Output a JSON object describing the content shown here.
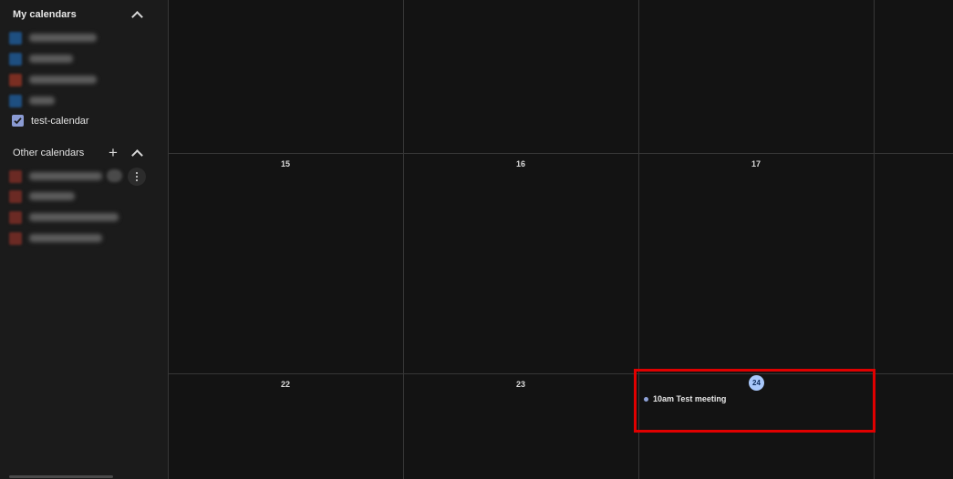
{
  "sidebar": {
    "my_calendars": {
      "title": "My calendars",
      "items": [
        {
          "label": "test-calendar",
          "checked": true,
          "color": "#8b9bd3"
        }
      ],
      "blurred_colors": [
        "#1e4f80",
        "#1e4f80",
        "#7a2e22",
        "#1e4f80"
      ]
    },
    "other_calendars": {
      "title": "Other calendars",
      "blurred_colors": [
        "#6b2a24",
        "#6b2a24",
        "#6b2a24",
        "#6b2a24"
      ]
    }
  },
  "calendar": {
    "week_rows": [
      [
        "",
        "",
        "",
        ""
      ],
      [
        "15",
        "16",
        "17",
        ""
      ],
      [
        "22",
        "23",
        "24",
        ""
      ]
    ],
    "today": "24",
    "events": [
      {
        "date": "24",
        "time": "10am",
        "title": "Test meeting",
        "text": "10am Test meeting",
        "color": "#8ea2d8"
      }
    ]
  },
  "colors": {
    "highlight": "#e00000",
    "today_circle": "#a8c7fa"
  }
}
